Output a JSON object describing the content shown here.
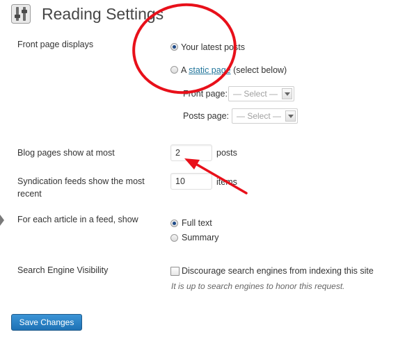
{
  "header": {
    "title": "Reading Settings"
  },
  "front_page": {
    "label": "Front page displays",
    "option_latest": "Your latest posts",
    "option_static_prefix": "A",
    "option_static_link": "static page",
    "option_static_suffix": "(select below)",
    "front_page_label": "Front page:",
    "front_page_value": "— Select —",
    "posts_page_label": "Posts page:",
    "posts_page_value": "— Select —"
  },
  "blog_pages": {
    "label": "Blog pages show at most",
    "value": "2",
    "unit": "posts"
  },
  "syndication": {
    "label_line1": "Syndication feeds show the most",
    "label_line2": "recent",
    "value": "10",
    "unit": "items"
  },
  "feed_article": {
    "label": "For each article in a feed, show",
    "option_full": "Full text",
    "option_summary": "Summary"
  },
  "search_visibility": {
    "label": "Search Engine Visibility",
    "checkbox_label": "Discourage search engines from indexing this site",
    "hint": "It is up to search engines to honor this request."
  },
  "footer": {
    "save_label": "Save Changes"
  },
  "colors": {
    "link": "#21759b",
    "button": "#2a85c8",
    "annotation": "#e8101a"
  }
}
